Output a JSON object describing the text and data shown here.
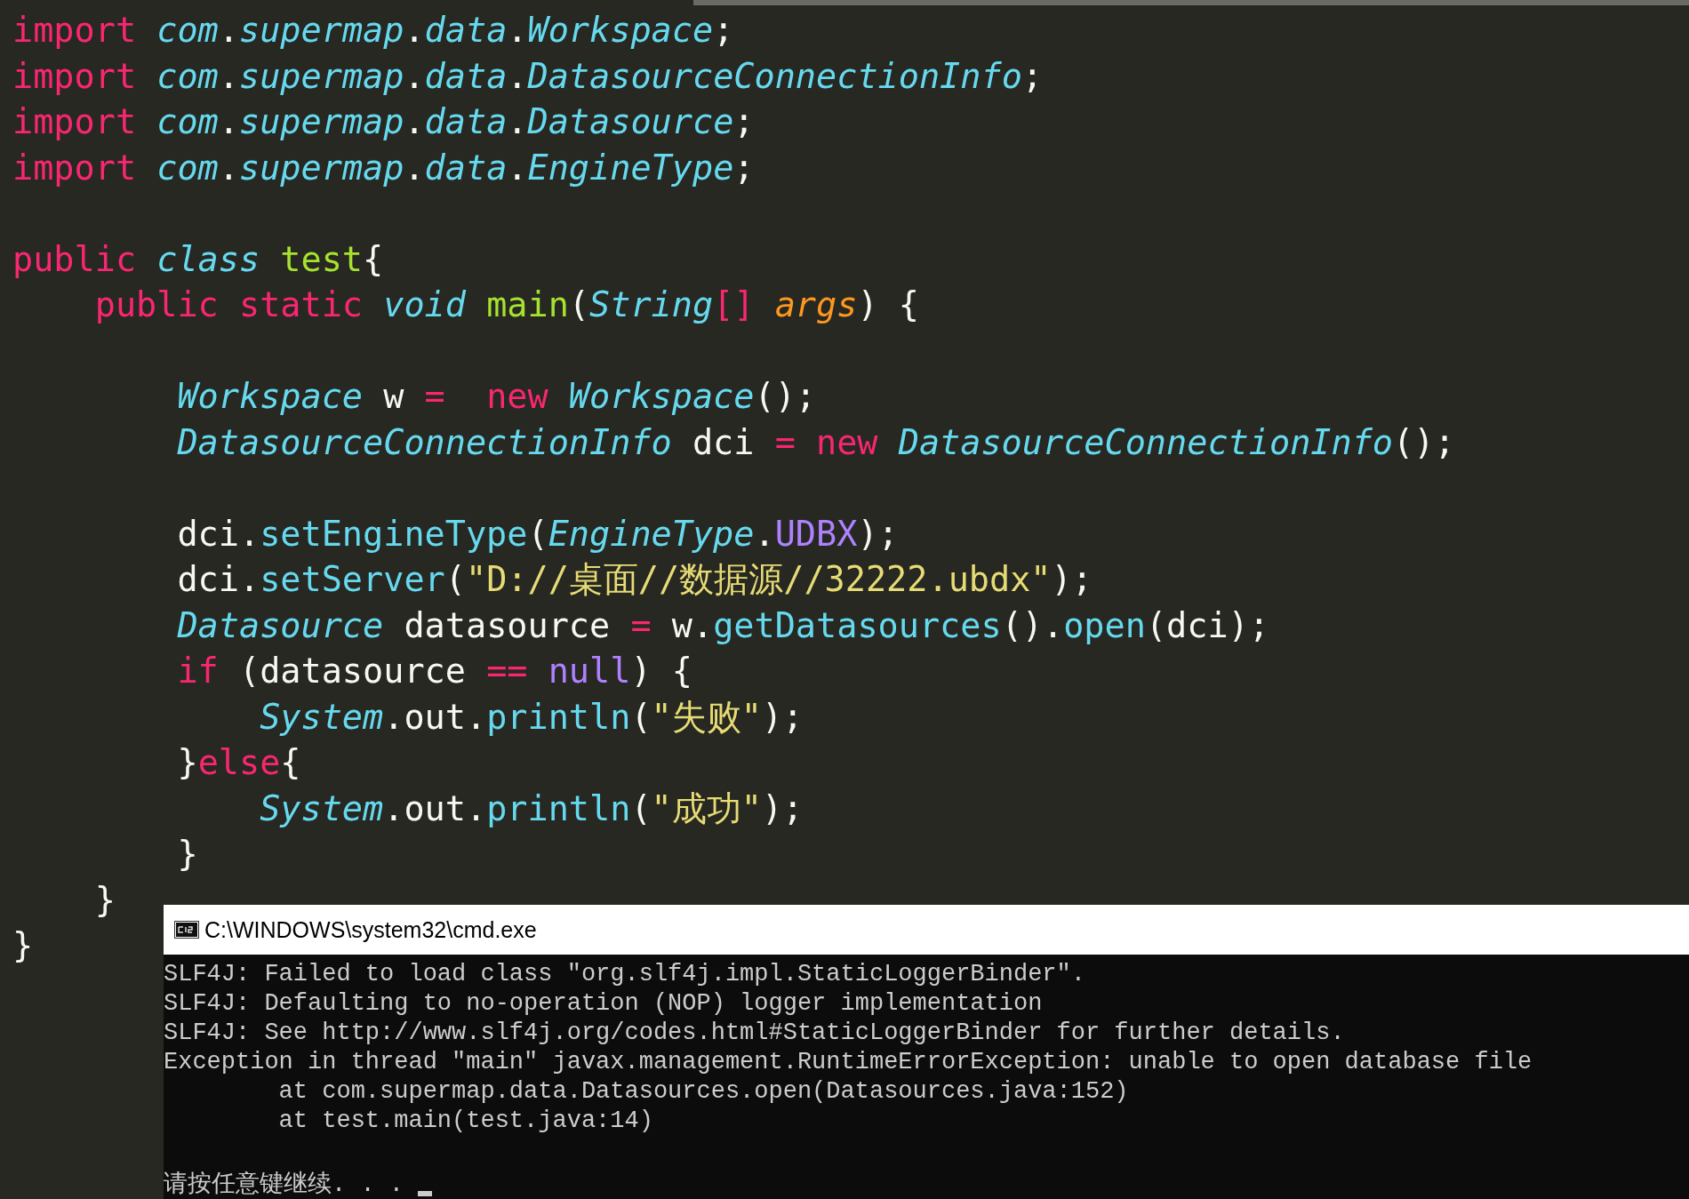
{
  "editor": {
    "lines": [
      {
        "kind": "code",
        "tokens": [
          {
            "text": "import",
            "kind": "keyword"
          },
          {
            "text": " com",
            "kind": "type"
          },
          {
            "text": ".",
            "kind": "plain"
          },
          {
            "text": "supermap",
            "kind": "type"
          },
          {
            "text": ".",
            "kind": "plain"
          },
          {
            "text": "data",
            "kind": "type"
          },
          {
            "text": ".",
            "kind": "plain"
          },
          {
            "text": "Workspace",
            "kind": "type"
          },
          {
            "text": ";",
            "kind": "plain"
          }
        ]
      },
      {
        "kind": "code",
        "tokens": [
          {
            "text": "import",
            "kind": "keyword"
          },
          {
            "text": " com",
            "kind": "type"
          },
          {
            "text": ".",
            "kind": "plain"
          },
          {
            "text": "supermap",
            "kind": "type"
          },
          {
            "text": ".",
            "kind": "plain"
          },
          {
            "text": "data",
            "kind": "type"
          },
          {
            "text": ".",
            "kind": "plain"
          },
          {
            "text": "DatasourceConnectionInfo",
            "kind": "type"
          },
          {
            "text": ";",
            "kind": "plain"
          }
        ]
      },
      {
        "kind": "code",
        "tokens": [
          {
            "text": "import",
            "kind": "keyword"
          },
          {
            "text": " com",
            "kind": "type"
          },
          {
            "text": ".",
            "kind": "plain"
          },
          {
            "text": "supermap",
            "kind": "type"
          },
          {
            "text": ".",
            "kind": "plain"
          },
          {
            "text": "data",
            "kind": "type"
          },
          {
            "text": ".",
            "kind": "plain"
          },
          {
            "text": "Datasource",
            "kind": "type"
          },
          {
            "text": ";",
            "kind": "plain"
          }
        ]
      },
      {
        "kind": "code",
        "tokens": [
          {
            "text": "import",
            "kind": "keyword"
          },
          {
            "text": " com",
            "kind": "type"
          },
          {
            "text": ".",
            "kind": "plain"
          },
          {
            "text": "supermap",
            "kind": "type"
          },
          {
            "text": ".",
            "kind": "plain"
          },
          {
            "text": "data",
            "kind": "type"
          },
          {
            "text": ".",
            "kind": "plain"
          },
          {
            "text": "EngineType",
            "kind": "type"
          },
          {
            "text": ";",
            "kind": "plain"
          }
        ]
      },
      {
        "kind": "blank"
      },
      {
        "kind": "code",
        "tokens": [
          {
            "text": "public",
            "kind": "keyword"
          },
          {
            "text": " class",
            "kind": "type"
          },
          {
            "text": " test",
            "kind": "name"
          },
          {
            "text": "{",
            "kind": "plain"
          }
        ]
      },
      {
        "kind": "code",
        "tokens": [
          {
            "text": "    public static",
            "kind": "keyword"
          },
          {
            "text": " void",
            "kind": "type"
          },
          {
            "text": " main",
            "kind": "name"
          },
          {
            "text": "(",
            "kind": "plain"
          },
          {
            "text": "String",
            "kind": "type"
          },
          {
            "text": "[]",
            "kind": "keyword"
          },
          {
            "text": " args",
            "kind": "param"
          },
          {
            "text": ") {",
            "kind": "plain"
          }
        ]
      },
      {
        "kind": "blank"
      },
      {
        "kind": "code",
        "tokens": [
          {
            "text": "        Workspace",
            "kind": "type"
          },
          {
            "text": " w ",
            "kind": "plain"
          },
          {
            "text": "=",
            "kind": "keyword"
          },
          {
            "text": "  new",
            "kind": "keyword"
          },
          {
            "text": " Workspace",
            "kind": "type"
          },
          {
            "text": "();",
            "kind": "plain"
          }
        ]
      },
      {
        "kind": "code",
        "tokens": [
          {
            "text": "        DatasourceConnectionInfo",
            "kind": "type"
          },
          {
            "text": " dci ",
            "kind": "plain"
          },
          {
            "text": "=",
            "kind": "keyword"
          },
          {
            "text": " new",
            "kind": "keyword"
          },
          {
            "text": " DatasourceConnectionInfo",
            "kind": "type"
          },
          {
            "text": "();",
            "kind": "plain"
          }
        ]
      },
      {
        "kind": "blank"
      },
      {
        "kind": "code",
        "tokens": [
          {
            "text": "        dci.",
            "kind": "plain"
          },
          {
            "text": "setEngineType",
            "kind": "func"
          },
          {
            "text": "(",
            "kind": "plain"
          },
          {
            "text": "EngineType",
            "kind": "type"
          },
          {
            "text": ".",
            "kind": "plain"
          },
          {
            "text": "UDBX",
            "kind": "constant"
          },
          {
            "text": ");",
            "kind": "plain"
          }
        ]
      },
      {
        "kind": "code",
        "tokens": [
          {
            "text": "        dci.",
            "kind": "plain"
          },
          {
            "text": "setServer",
            "kind": "func"
          },
          {
            "text": "(",
            "kind": "plain"
          },
          {
            "text": "\"D://桌面//数据源//32222.ubdx\"",
            "kind": "string"
          },
          {
            "text": ");",
            "kind": "plain"
          }
        ]
      },
      {
        "kind": "code",
        "tokens": [
          {
            "text": "        Datasource",
            "kind": "type"
          },
          {
            "text": " datasource ",
            "kind": "plain"
          },
          {
            "text": "=",
            "kind": "keyword"
          },
          {
            "text": " w.",
            "kind": "plain"
          },
          {
            "text": "getDatasources",
            "kind": "func"
          },
          {
            "text": "().",
            "kind": "plain"
          },
          {
            "text": "open",
            "kind": "func"
          },
          {
            "text": "(dci);",
            "kind": "plain"
          }
        ]
      },
      {
        "kind": "code",
        "tokens": [
          {
            "text": "        if",
            "kind": "keyword"
          },
          {
            "text": " (datasource ",
            "kind": "plain"
          },
          {
            "text": "==",
            "kind": "keyword"
          },
          {
            "text": " null",
            "kind": "constant"
          },
          {
            "text": ") {",
            "kind": "plain"
          }
        ]
      },
      {
        "kind": "code",
        "tokens": [
          {
            "text": "            System",
            "kind": "type"
          },
          {
            "text": ".out.",
            "kind": "plain"
          },
          {
            "text": "println",
            "kind": "func"
          },
          {
            "text": "(",
            "kind": "plain"
          },
          {
            "text": "\"失败\"",
            "kind": "string"
          },
          {
            "text": ");",
            "kind": "plain"
          }
        ]
      },
      {
        "kind": "code",
        "tokens": [
          {
            "text": "        }",
            "kind": "plain"
          },
          {
            "text": "else",
            "kind": "keyword"
          },
          {
            "text": "{",
            "kind": "plain"
          }
        ]
      },
      {
        "kind": "code",
        "tokens": [
          {
            "text": "            System",
            "kind": "type"
          },
          {
            "text": ".out.",
            "kind": "plain"
          },
          {
            "text": "println",
            "kind": "func"
          },
          {
            "text": "(",
            "kind": "plain"
          },
          {
            "text": "\"成功\"",
            "kind": "string"
          },
          {
            "text": ");",
            "kind": "plain"
          }
        ]
      },
      {
        "kind": "code",
        "tokens": [
          {
            "text": "        }",
            "kind": "plain"
          }
        ]
      },
      {
        "kind": "code",
        "tokens": [
          {
            "text": "    }",
            "kind": "plain"
          }
        ]
      },
      {
        "kind": "code",
        "tokens": [
          {
            "text": "}",
            "kind": "plain"
          }
        ]
      }
    ]
  },
  "console": {
    "title": "C:\\WINDOWS\\system32\\cmd.exe",
    "lines": [
      {
        "kind": "output",
        "text": "SLF4J: Failed to load class \"org.slf4j.impl.StaticLoggerBinder\"."
      },
      {
        "kind": "output",
        "text": "SLF4J: Defaulting to no-operation (NOP) logger implementation"
      },
      {
        "kind": "output",
        "text": "SLF4J: See http://www.slf4j.org/codes.html#StaticLoggerBinder for further details."
      },
      {
        "kind": "output",
        "text": "Exception in thread \"main\" javax.management.RuntimeErrorException: unable to open database file"
      },
      {
        "kind": "output",
        "text": "        at com.supermap.data.Datasources.open(Datasources.java:152)"
      },
      {
        "kind": "output",
        "text": "        at test.main(test.java:14)"
      },
      {
        "kind": "blank"
      },
      {
        "kind": "prompt",
        "text": "请按任意键继续. . . ",
        "cursor": true
      }
    ]
  }
}
